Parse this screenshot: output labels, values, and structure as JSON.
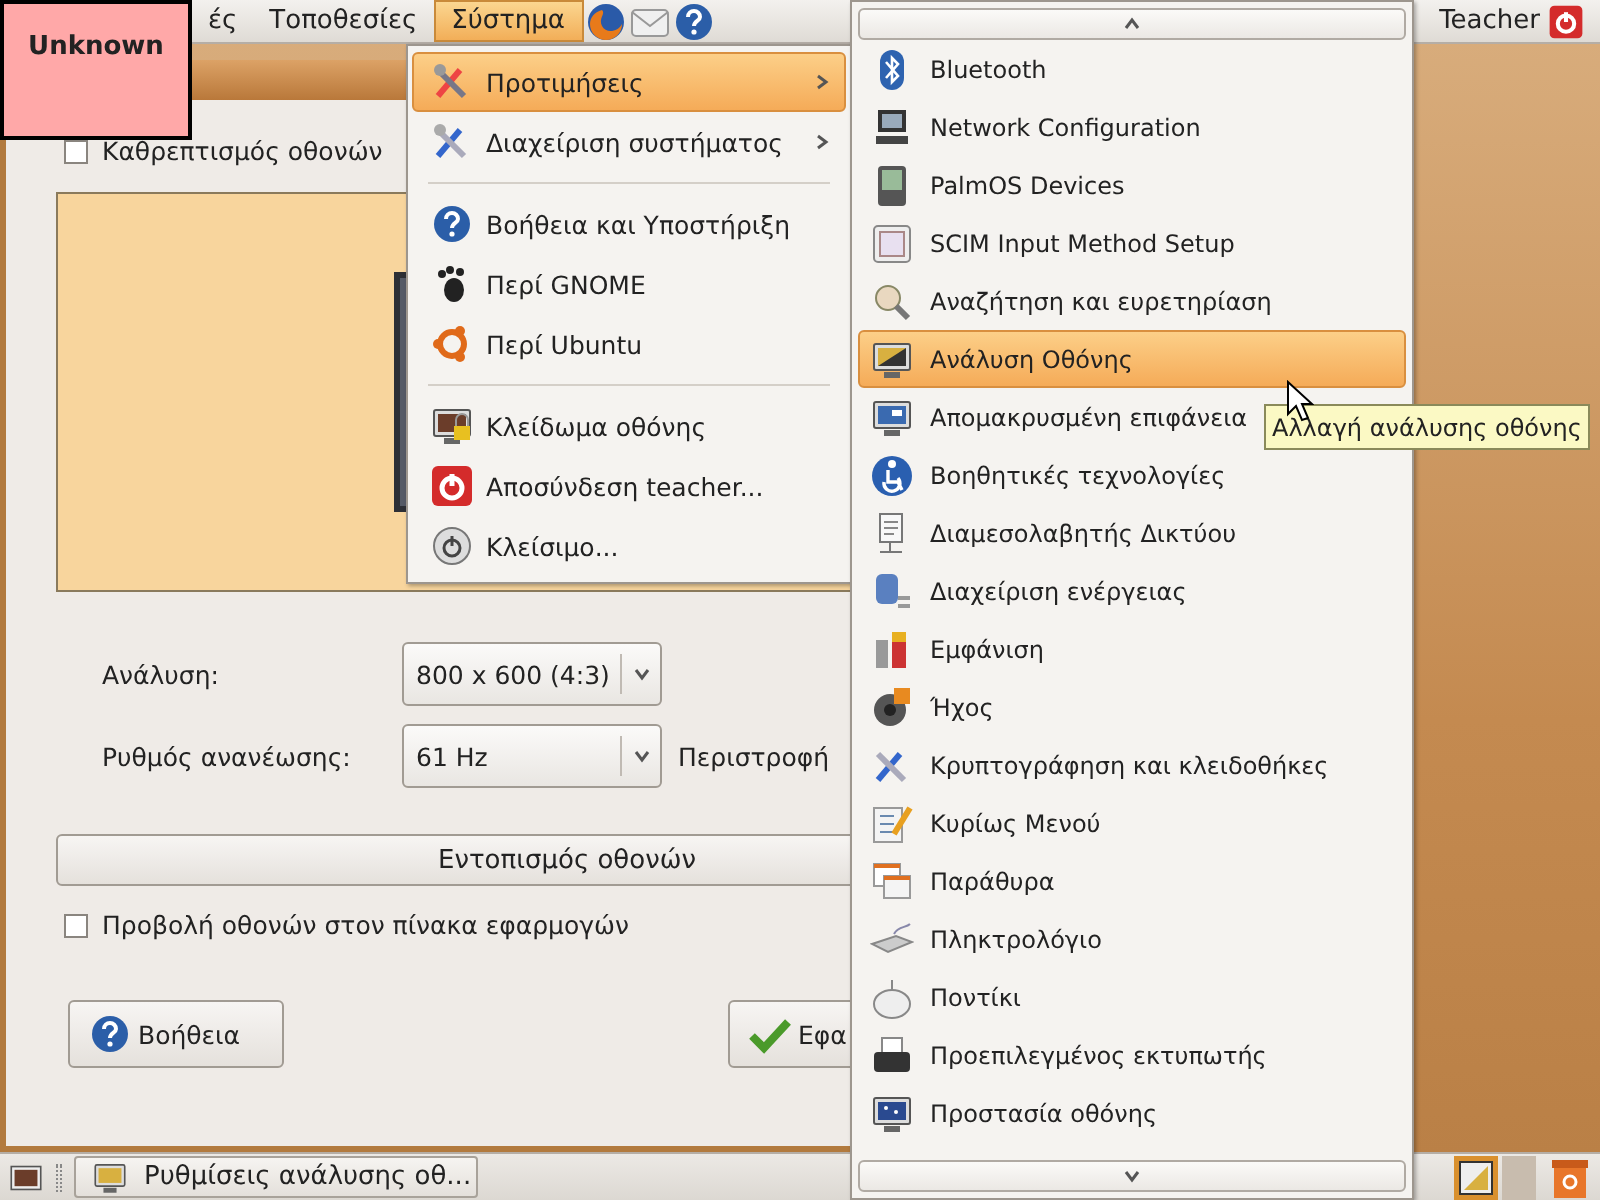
{
  "top_panel": {
    "menus": [
      {
        "label": "ές",
        "selected": false
      },
      {
        "label": "Τοποθεσίες",
        "selected": false
      },
      {
        "label": "Σύστημα",
        "selected": true
      }
    ],
    "user": "Teacher"
  },
  "badge": {
    "label": "Unknown"
  },
  "window": {
    "mirror_checkbox": {
      "label": "Καθρεπτισμός οθονών",
      "checked": false
    },
    "resolution": {
      "label": "Ανάλυση:",
      "value": "800 x 600 (4:3)"
    },
    "refresh_rate": {
      "label": "Ρυθμός ανανέωσης:",
      "value": "61 Hz"
    },
    "rotation": {
      "label": "Περιστροφή"
    },
    "detect_button": "Εντοπισμός οθονών",
    "panel_checkbox": {
      "label": "Προβολή οθονών στον πίνακα εφαρμογών",
      "checked": false
    },
    "buttons": [
      "Βοήθεια",
      "Εφα"
    ]
  },
  "system_menu": {
    "items": [
      {
        "kind": "item",
        "label": "Προτιμήσεις",
        "submenu": true,
        "selected": true
      },
      {
        "kind": "item",
        "label": "Διαχείριση συστήματος",
        "submenu": true,
        "selected": false
      },
      {
        "kind": "separator"
      },
      {
        "kind": "item",
        "label": "Βοήθεια και Υποστήριξη",
        "submenu": false,
        "selected": false
      },
      {
        "kind": "item",
        "label": "Περί GNOME",
        "submenu": false,
        "selected": false
      },
      {
        "kind": "item",
        "label": "Περί Ubuntu",
        "submenu": false,
        "selected": false
      },
      {
        "kind": "separator"
      },
      {
        "kind": "item",
        "label": "Κλείδωμα οθόνης",
        "submenu": false,
        "selected": false
      },
      {
        "kind": "item",
        "label": "Αποσύνδεση teacher...",
        "submenu": false,
        "selected": false
      },
      {
        "kind": "item",
        "label": "Κλείσιμο...",
        "submenu": false,
        "selected": false
      }
    ]
  },
  "submenu": {
    "items": [
      {
        "label": "Bluetooth",
        "selected": false
      },
      {
        "label": "Network Configuration",
        "selected": false
      },
      {
        "label": "PalmOS Devices",
        "selected": false
      },
      {
        "label": "SCIM Input Method Setup",
        "selected": false
      },
      {
        "label": "Αναζήτηση και ευρετηρίαση",
        "selected": false
      },
      {
        "label": "Ανάλυση Οθόνης",
        "selected": true
      },
      {
        "label": "Απομακρυσμένη επιφάνεια",
        "selected": false
      },
      {
        "label": "Βοηθητικές τεχνολογίες",
        "selected": false
      },
      {
        "label": "Διαμεσολαβητής Δικτύου",
        "selected": false
      },
      {
        "label": "Διαχείριση ενέργειας",
        "selected": false
      },
      {
        "label": "Εμφάνιση",
        "selected": false
      },
      {
        "label": "Ήχος",
        "selected": false
      },
      {
        "label": "Κρυπτογράφηση και κλειδοθήκες",
        "selected": false
      },
      {
        "label": "Κυρίως Μενού",
        "selected": false
      },
      {
        "label": "Παράθυρα",
        "selected": false
      },
      {
        "label": "Πληκτρολόγιο",
        "selected": false
      },
      {
        "label": "Ποντίκι",
        "selected": false
      },
      {
        "label": "Προεπιλεγμένος εκτυπωτής",
        "selected": false
      },
      {
        "label": "Προστασία οθόνης",
        "selected": false
      }
    ]
  },
  "tooltip": "Αλλαγή ανάλυσης οθόνης",
  "bottom_panel": {
    "tasks": [
      {
        "label": "Ρυθμίσεις ανάλυσης οθ..."
      }
    ]
  }
}
